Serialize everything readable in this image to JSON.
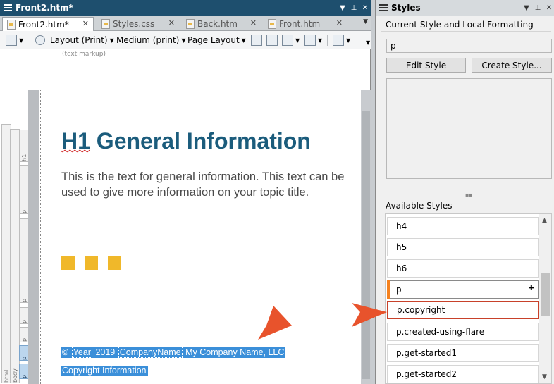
{
  "editor": {
    "title": "Front2.htm*",
    "tabs": [
      {
        "label": "Front2.htm*"
      },
      {
        "label": "Styles.css"
      },
      {
        "label": "Back.htm"
      },
      {
        "label": "Front.htm"
      }
    ],
    "toolbar": {
      "layout": "Layout (Print)",
      "medium": "Medium (print)",
      "page_layout": "Page Layout"
    },
    "text_markup_label": "(text markup)",
    "structure_tags": [
      "html",
      "body",
      "h1",
      "p",
      "p",
      "p",
      "p",
      "p",
      "p"
    ],
    "content": {
      "heading_prefix": "H1",
      "heading_text": " General Information",
      "paragraph": "This is the text for general information. This text can be used to give more information on your topic title.",
      "footer_parts": [
        "©",
        "Year",
        "2019",
        "CompanyName",
        "My Company Name, LLC"
      ],
      "copyright_label": "Copyright Information"
    }
  },
  "styles_pane": {
    "title": "Styles",
    "current_label": "Current Style and Local Formatting",
    "current_value": "p",
    "edit_button": "Edit Style",
    "create_button": "Create Style...",
    "available_label": "Available Styles",
    "items": [
      "h4",
      "h5",
      "h6",
      "p",
      "p.copyright",
      "p.created-using-flare",
      "p.get-started1",
      "p.get-started2"
    ],
    "current_index": 3,
    "highlighted_index": 4
  },
  "colors": {
    "title_bar": "#1e4f6e",
    "heading": "#1b5c7c",
    "accent_squares": "#f0b82a",
    "selection": "#3b8fd9",
    "callout_arrow": "#e8532c",
    "current_marker": "#f5821f"
  }
}
